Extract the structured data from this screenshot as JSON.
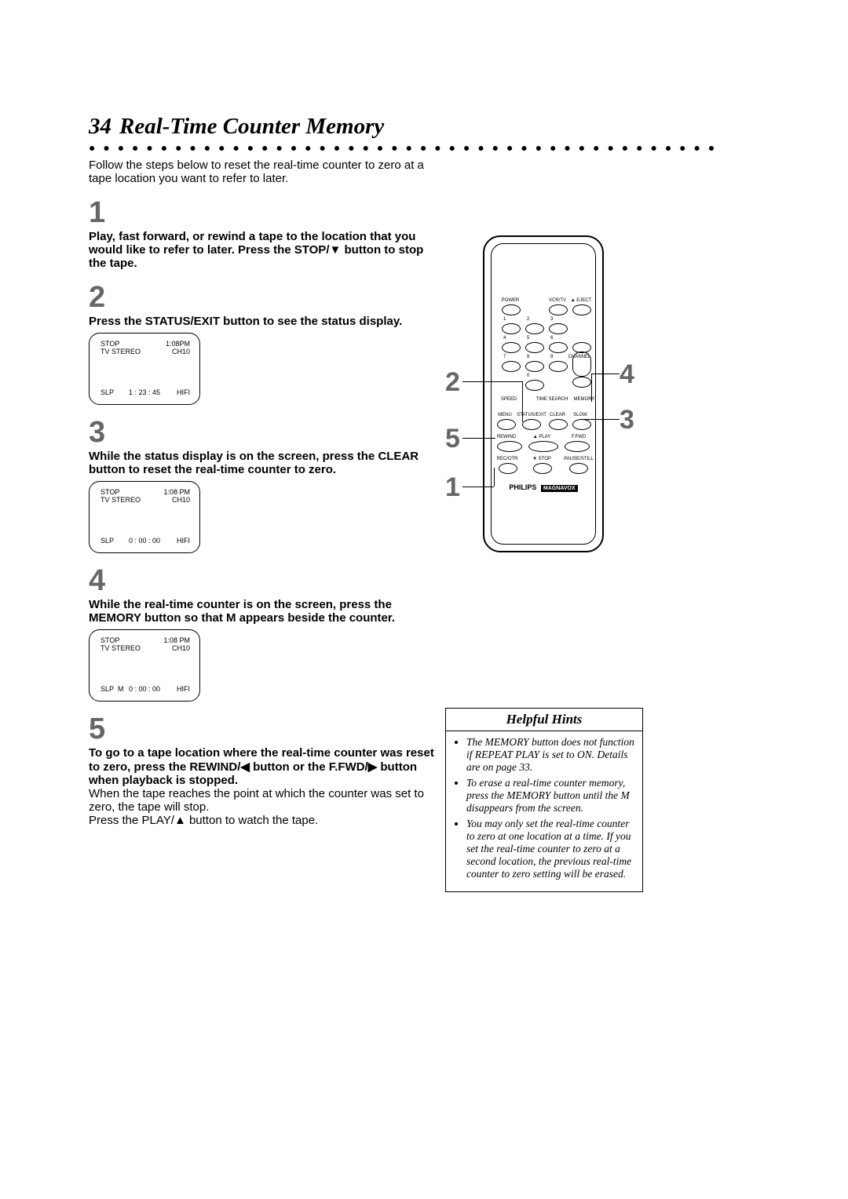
{
  "header": {
    "page_number": "34",
    "title": "Real-Time Counter Memory"
  },
  "intro": "Follow the steps below to reset the real-time counter to zero at a tape location you want to refer to later.",
  "steps": {
    "s1": {
      "num": "1",
      "text": "Play, fast forward, or rewind a tape to the location that you would like to refer to later. Press the STOP/▼ button to stop the tape."
    },
    "s2": {
      "num": "2",
      "text": "Press the STATUS/EXIT button to see the status display.",
      "display": {
        "stop": "STOP",
        "stereo": "TV STEREO",
        "time": "1:08PM",
        "ch": "CH10",
        "slp": "SLP",
        "counter": "1 : 23 : 45",
        "hifi": "HIFI"
      }
    },
    "s3": {
      "num": "3",
      "text": "While the status display is on the screen, press the CLEAR button to reset the real-time counter to zero.",
      "display": {
        "stop": "STOP",
        "stereo": "TV STEREO",
        "time": "1:08 PM",
        "ch": "CH10",
        "slp": "SLP",
        "counter": "0 : 00 : 00",
        "hifi": "HIFI"
      }
    },
    "s4": {
      "num": "4",
      "text": "While the real-time counter is on the screen, press the MEMORY button so that M appears beside the counter.",
      "display": {
        "stop": "STOP",
        "stereo": "TV STEREO",
        "time": "1:08 PM",
        "ch": "CH10",
        "slp": "SLP",
        "m": "M",
        "counter": "0 : 00 : 00",
        "hifi": "HIFI"
      }
    },
    "s5": {
      "num": "5",
      "bold": "To go to a tape location where the real-time counter was reset to zero, press the REWIND/◀ button or the F.FWD/▶ button when playback is stopped.",
      "body1": "When the tape reaches the point at which the counter was set to zero, the tape will stop.",
      "body2": "Press the PLAY/▲ button to watch the tape."
    }
  },
  "remote": {
    "labels": {
      "power": "POWER",
      "vcrtv": "VCR/TV",
      "eject": "▲ EJECT",
      "d1": "1",
      "d2": "2",
      "d3": "3",
      "d4": "4",
      "d5": "5",
      "d6": "6",
      "d7": "7",
      "d8": "8",
      "d9": "9",
      "d0": "0",
      "channel": "CHANNEL",
      "speed": "SPEED",
      "timesearch": "TIME SEARCH",
      "memory": "MEMORY",
      "menu": "MENU",
      "status": "STATUS/EXIT",
      "clear": "CLEAR",
      "slow": "SLOW",
      "rewind": "REWIND",
      "play": "▲ PLAY",
      "ffwd": "F.FWD",
      "recotr": "REC/OTR",
      "stop": "▼ STOP",
      "pause": "PAUSE/STILL",
      "brand": "PHILIPS",
      "brand2": "MAGNAVOX"
    },
    "callouts": {
      "c1": "1",
      "c2": "2",
      "c3": "3",
      "c4": "4",
      "c5": "5"
    }
  },
  "hints": {
    "title": "Helpful Hints",
    "items": [
      "The MEMORY button does not function if REPEAT PLAY is set to ON. Details are on page 33.",
      "To erase a real-time counter memory, press the MEMORY button until the M disappears from the screen.",
      "You may only set the real-time counter to zero at one location at a time. If you set the real-time counter to zero at a second location, the previous real-time counter to zero setting will be erased."
    ]
  }
}
